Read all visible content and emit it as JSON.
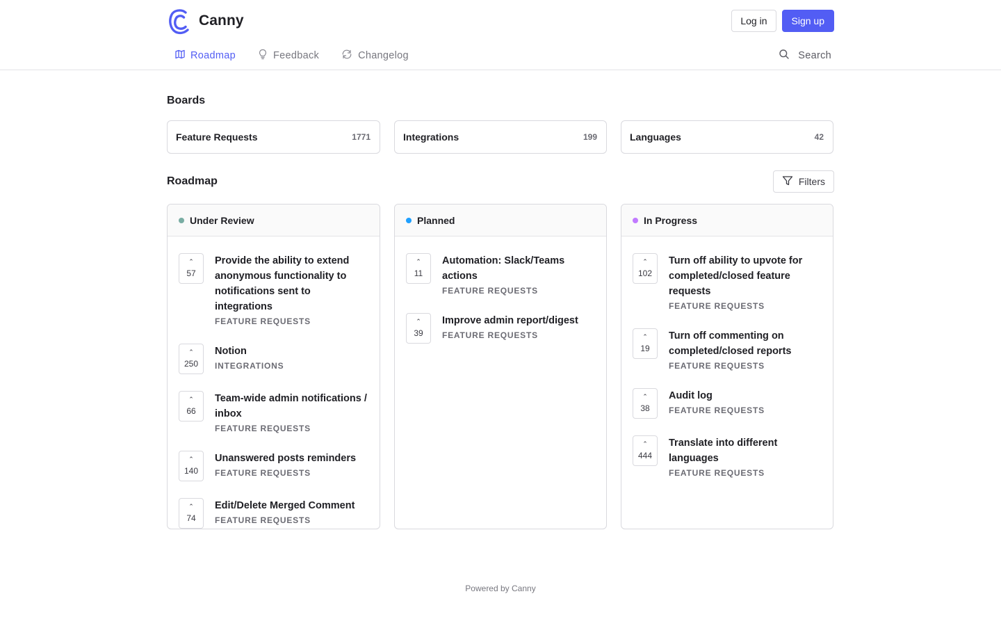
{
  "brand": {
    "name": "Canny"
  },
  "auth": {
    "login_label": "Log in",
    "signup_label": "Sign up"
  },
  "nav": {
    "items": [
      {
        "label": "Roadmap",
        "icon": "map-icon",
        "active": true
      },
      {
        "label": "Feedback",
        "icon": "lightbulb-icon",
        "active": false
      },
      {
        "label": "Changelog",
        "icon": "refresh-icon",
        "active": false
      }
    ],
    "search_label": "Search"
  },
  "boards": {
    "title": "Boards",
    "items": [
      {
        "name": "Feature Requests",
        "count": "1771"
      },
      {
        "name": "Integrations",
        "count": "199"
      },
      {
        "name": "Languages",
        "count": "42"
      }
    ]
  },
  "roadmap": {
    "title": "Roadmap",
    "filters_label": "Filters",
    "columns": [
      {
        "title": "Under Review",
        "color": "#79ada3",
        "posts": [
          {
            "votes": "57",
            "title": "Provide the ability to extend anonymous functionality to notifications sent to integrations",
            "board": "FEATURE REQUESTS"
          },
          {
            "votes": "250",
            "title": "Notion",
            "board": "INTEGRATIONS"
          },
          {
            "votes": "66",
            "title": "Team-wide admin notifications / inbox",
            "board": "FEATURE REQUESTS"
          },
          {
            "votes": "140",
            "title": "Unanswered posts reminders",
            "board": "FEATURE REQUESTS"
          },
          {
            "votes": "74",
            "title": "Edit/Delete Merged Comment",
            "board": "FEATURE REQUESTS"
          }
        ]
      },
      {
        "title": "Planned",
        "color": "#1fa0ff",
        "posts": [
          {
            "votes": "11",
            "title": "Automation: Slack/Teams actions",
            "board": "FEATURE REQUESTS"
          },
          {
            "votes": "39",
            "title": "Improve admin report/digest",
            "board": "FEATURE REQUESTS"
          }
        ]
      },
      {
        "title": "In Progress",
        "color": "#c17aff",
        "posts": [
          {
            "votes": "102",
            "title": "Turn off ability to upvote for completed/closed feature requests",
            "board": "FEATURE REQUESTS"
          },
          {
            "votes": "19",
            "title": "Turn off commenting on completed/closed reports",
            "board": "FEATURE REQUESTS"
          },
          {
            "votes": "38",
            "title": "Audit log",
            "board": "FEATURE REQUESTS"
          },
          {
            "votes": "444",
            "title": "Translate into different languages",
            "board": "FEATURE REQUESTS"
          }
        ]
      }
    ]
  },
  "footer": {
    "text": "Powered by Canny"
  },
  "colors": {
    "accent": "#525df4"
  }
}
